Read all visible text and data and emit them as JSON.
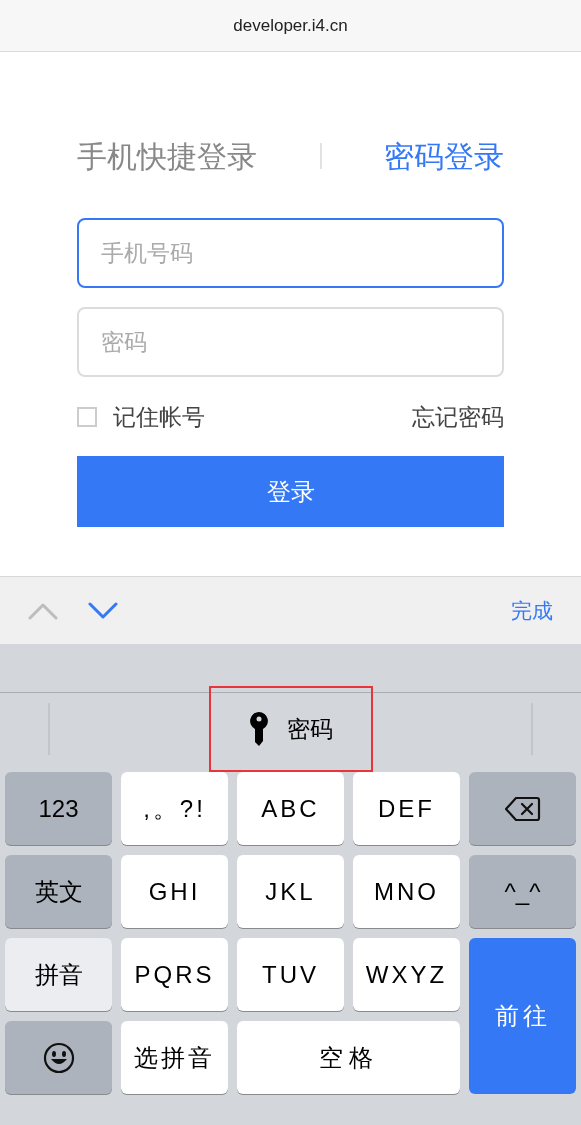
{
  "address_bar": {
    "url": "developer.i4.cn"
  },
  "login_tabs": [
    {
      "label": "手机快捷登录",
      "selected": false
    },
    {
      "label": "密码登录",
      "selected": true
    }
  ],
  "fields": [
    {
      "placeholder": "手机号码",
      "focused": true
    },
    {
      "placeholder": "密码",
      "focused": false
    }
  ],
  "remember": {
    "label": "记住帐号",
    "checked": false
  },
  "forgot_link": "忘记密码",
  "login_button": "登录",
  "form_toolbar": {
    "prev_enabled": false,
    "next_enabled": true,
    "done": "完成"
  },
  "suggestion": {
    "label": "密码",
    "highlighted": true
  },
  "keys": [
    {
      "kind": "function",
      "label": "123"
    },
    {
      "kind": "letter",
      "label": ",。?!"
    },
    {
      "kind": "letter",
      "label": "ABC"
    },
    {
      "kind": "letter",
      "label": "DEF"
    },
    {
      "kind": "delete"
    },
    {
      "kind": "function",
      "label": "英文"
    },
    {
      "kind": "letter",
      "label": "GHI"
    },
    {
      "kind": "letter",
      "label": "JKL"
    },
    {
      "kind": "letter",
      "label": "MNO"
    },
    {
      "kind": "function",
      "label": "^_^"
    },
    {
      "kind": "mode",
      "label": "拼音"
    },
    {
      "kind": "letter",
      "label": "PQRS"
    },
    {
      "kind": "letter",
      "label": "TUV"
    },
    {
      "kind": "letter",
      "label": "WXYZ"
    },
    {
      "kind": "go",
      "label": "前往"
    },
    {
      "kind": "emoji"
    },
    {
      "kind": "letter",
      "label": "选拼音"
    },
    {
      "kind": "space",
      "label": "空格"
    }
  ]
}
